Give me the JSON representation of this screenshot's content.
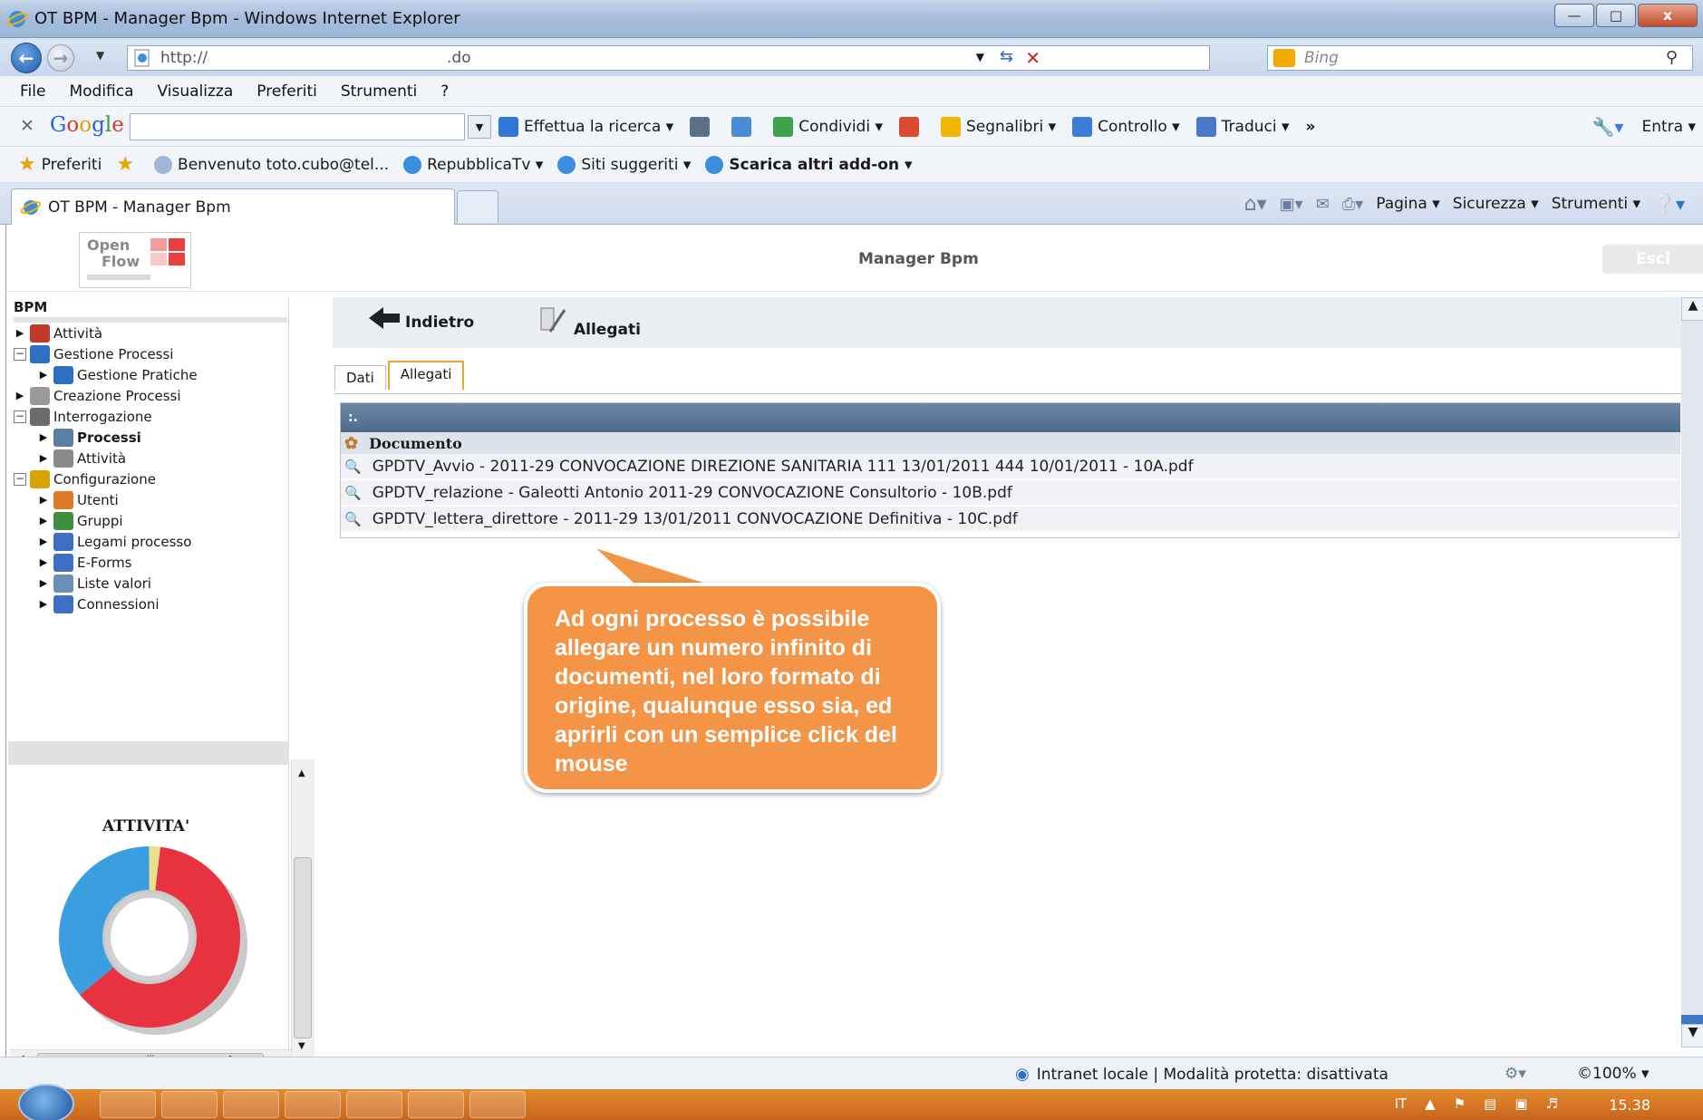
{
  "window": {
    "title": "OT BPM - Manager Bpm - Windows Internet Explorer",
    "controls": {
      "minimize": "—",
      "maximize": "□",
      "close": "x"
    }
  },
  "address": {
    "url_prefix": "http://",
    "url_suffix": ".do",
    "search_placeholder": "Bing"
  },
  "menubar": [
    "File",
    "Modifica",
    "Visualizza",
    "Preferiti",
    "Strumenti",
    "?"
  ],
  "google_toolbar": {
    "logo": [
      "G",
      "o",
      "o",
      "g",
      "l",
      "e"
    ],
    "items": [
      {
        "label": "Effettua la ricerca ▾",
        "icon": "search-icon",
        "color": "#2f77d9"
      },
      {
        "label": "",
        "icon": "popup-icon",
        "color": "#5a6f8a"
      },
      {
        "label": "",
        "icon": "puzzle-icon",
        "color": "#4a8bd6"
      },
      {
        "label": "Condividi ▾",
        "icon": "share-icon",
        "color": "#3ca34a"
      },
      {
        "label": "",
        "icon": "mail-icon",
        "color": "#d94a2e"
      },
      {
        "label": "Segnalibri ▾",
        "icon": "star-icon",
        "color": "#f0b600"
      },
      {
        "label": "Controllo ▾",
        "icon": "spellcheck-icon",
        "color": "#3b7dd8"
      },
      {
        "label": "Traduci ▾",
        "icon": "translate-icon",
        "color": "#4a79c9"
      }
    ],
    "more": "»",
    "right": {
      "entra": "Entra ▾"
    }
  },
  "favorites": [
    {
      "label": "Preferiti",
      "icon": "star-icon"
    },
    {
      "label": "",
      "icon": "add-favorite-icon"
    },
    {
      "label": "Benvenuto toto.cubo@tel...",
      "icon": "mail-icon"
    },
    {
      "label": "RepubblicaTv ▾",
      "icon": "ie-page-icon"
    },
    {
      "label": "Siti suggeriti ▾",
      "icon": "ie-icon"
    },
    {
      "label": "Scarica altri add-on ▾",
      "icon": "ie-page-icon"
    }
  ],
  "tab": {
    "label": "OT BPM - Manager Bpm"
  },
  "commandbar": [
    "Pagina ▾",
    "Sicurezza ▾",
    "Strumenti ▾"
  ],
  "app": {
    "logo_line1": "Open",
    "logo_line2": "Flow",
    "title": "Manager Bpm",
    "logout": "Esci"
  },
  "sidebar": {
    "title": "BPM",
    "tree": [
      {
        "label": "Attività",
        "level": 0,
        "toggle": "arrow",
        "icon_color": "#c0392b",
        "bold": false
      },
      {
        "label": "Gestione Processi",
        "level": 0,
        "toggle": "minus",
        "icon_color": "#2d6fc4",
        "bold": false
      },
      {
        "label": "Gestione Pratiche",
        "level": 1,
        "toggle": "arrow",
        "icon_color": "#2d6fc4",
        "bold": false
      },
      {
        "label": "Creazione Processi",
        "level": 0,
        "toggle": "arrow",
        "icon_color": "#9a9a9a",
        "bold": false
      },
      {
        "label": "Interrogazione",
        "level": 0,
        "toggle": "minus",
        "icon_color": "#6b6b6b",
        "bold": false
      },
      {
        "label": "Processi",
        "level": 1,
        "toggle": "arrow",
        "icon_color": "#5a7fa6",
        "bold": true
      },
      {
        "label": "Attività",
        "level": 1,
        "toggle": "arrow",
        "icon_color": "#8a8a8a",
        "bold": false
      },
      {
        "label": "Configurazione",
        "level": 0,
        "toggle": "minus",
        "icon_color": "#d9a400",
        "bold": false
      },
      {
        "label": "Utenti",
        "level": 1,
        "toggle": "arrow",
        "icon_color": "#e07a2a",
        "bold": false
      },
      {
        "label": "Gruppi",
        "level": 1,
        "toggle": "arrow",
        "icon_color": "#3f8f3f",
        "bold": false
      },
      {
        "label": "Legami processo",
        "level": 1,
        "toggle": "arrow",
        "icon_color": "#3f6fc4",
        "bold": false
      },
      {
        "label": "E-Forms",
        "level": 1,
        "toggle": "arrow",
        "icon_color": "#3f6fc4",
        "bold": false
      },
      {
        "label": "Liste valori",
        "level": 1,
        "toggle": "arrow",
        "icon_color": "#6a8fb8",
        "bold": false
      },
      {
        "label": "Connessioni",
        "level": 1,
        "toggle": "arrow",
        "icon_color": "#3f6fc4",
        "bold": false
      }
    ]
  },
  "chart_data": {
    "type": "pie",
    "title": "ATTIVITA'",
    "donut": true,
    "slices": [
      {
        "value": 62,
        "color": "#e8323f"
      },
      {
        "value": 36,
        "color": "#3a9ee0"
      },
      {
        "value": 2,
        "color": "#e8e18a"
      }
    ]
  },
  "main": {
    "buttons": {
      "back": "Indietro",
      "attachments": "Allegati"
    },
    "tabs": [
      {
        "label": "Dati",
        "active": false
      },
      {
        "label": "Allegati",
        "active": true
      }
    ],
    "table": {
      "header_marker": ":.",
      "column": "Documento",
      "rows": [
        "GPDTV_Avvio - 2011-29 CONVOCAZIONE DIREZIONE SANITARIA 111 13/01/2011 444 10/01/2011 - 10A.pdf",
        "GPDTV_relazione - Galeotti Antonio 2011-29 CONVOCAZIONE Consultorio - 10B.pdf",
        "GPDTV_lettera_direttore - 2011-29 13/01/2011 CONVOCAZIONE Definitiva - 10C.pdf"
      ]
    }
  },
  "callout": {
    "text": "Ad ogni processo è possibile allegare un numero infinito di documenti, nel loro formato di origine, qualunque esso sia, ed aprirli con un semplice click del mouse",
    "color": "#f39447"
  },
  "statusbar": {
    "zone": "Intranet locale | Modalità protetta: disattivata",
    "zoom": "©100% ▾"
  },
  "taskbar": {
    "lang": "IT",
    "time": "15.38"
  }
}
